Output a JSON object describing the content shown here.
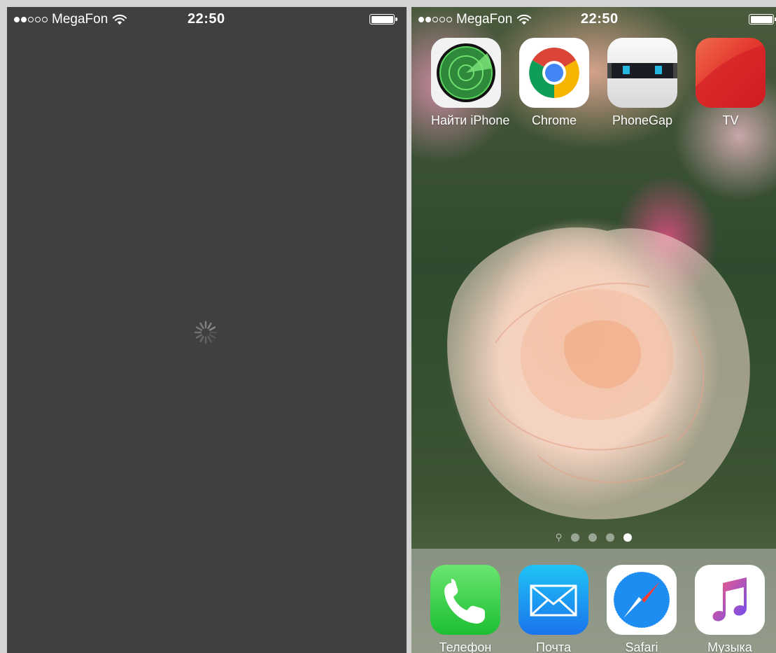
{
  "left_screen": {
    "status": {
      "carrier": "MegaFon",
      "time": "22:50"
    }
  },
  "right_screen": {
    "status": {
      "carrier": "MegaFon",
      "time": "22:50"
    },
    "apps": [
      {
        "name": "Найти iPhone",
        "icon": "find-iphone-radar-icon"
      },
      {
        "name": "Chrome",
        "icon": "chrome-icon"
      },
      {
        "name": "PhoneGap",
        "icon": "phonegap-icon"
      },
      {
        "name": "TV",
        "icon": "tv-icon"
      }
    ],
    "page_indicator": {
      "pages": 4,
      "active_page": 4,
      "has_search_page": true
    },
    "dock": [
      {
        "name": "Телефон",
        "icon": "phone-icon"
      },
      {
        "name": "Почта",
        "icon": "mail-icon"
      },
      {
        "name": "Safari",
        "icon": "safari-compass-icon"
      },
      {
        "name": "Музыка",
        "icon": "music-note-icon"
      }
    ]
  },
  "colors": {
    "loading_background": "#404040",
    "status_text": "#ffffff",
    "phone_green": "#4cd964",
    "mail_blue": "#1f8ef1",
    "tv_red": "#e0282c"
  }
}
